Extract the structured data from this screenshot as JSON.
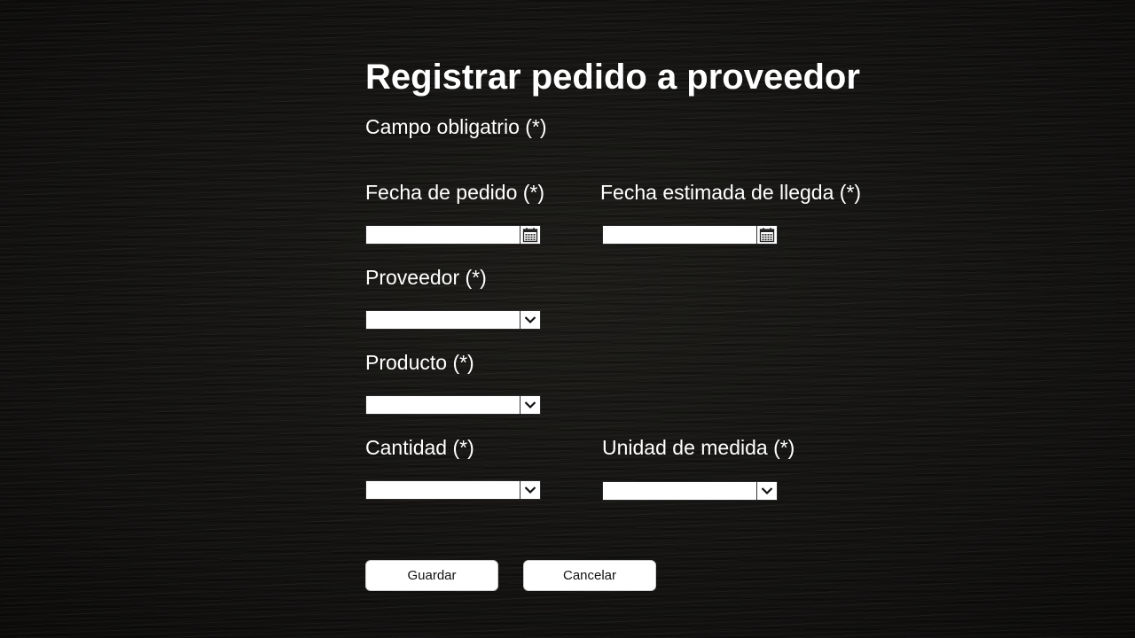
{
  "page": {
    "title": "Registrar pedido a proveedor",
    "required_note": "Campo obligatrio (*)"
  },
  "form": {
    "fecha_pedido": {
      "label": "Fecha de pedido (*)",
      "value": "",
      "icon": "calendar-icon"
    },
    "fecha_llegada": {
      "label": "Fecha estimada de llegda (*)",
      "value": "",
      "icon": "calendar-icon"
    },
    "proveedor": {
      "label": "Proveedor (*)",
      "value": "",
      "icon": "chevron-down-icon"
    },
    "producto": {
      "label": "Producto (*)",
      "value": "",
      "icon": "chevron-down-icon"
    },
    "cantidad": {
      "label": "Cantidad (*)",
      "value": "",
      "icon": "chevron-down-icon"
    },
    "unidad": {
      "label": "Unidad de medida (*)",
      "value": "",
      "icon": "chevron-down-icon"
    }
  },
  "actions": {
    "save_label": "Guardar",
    "cancel_label": "Cancelar"
  },
  "colors": {
    "background": "#141311",
    "text": "#ffffff",
    "field_background": "#ffffff",
    "button_background": "#ffffff",
    "button_text": "#111111"
  }
}
